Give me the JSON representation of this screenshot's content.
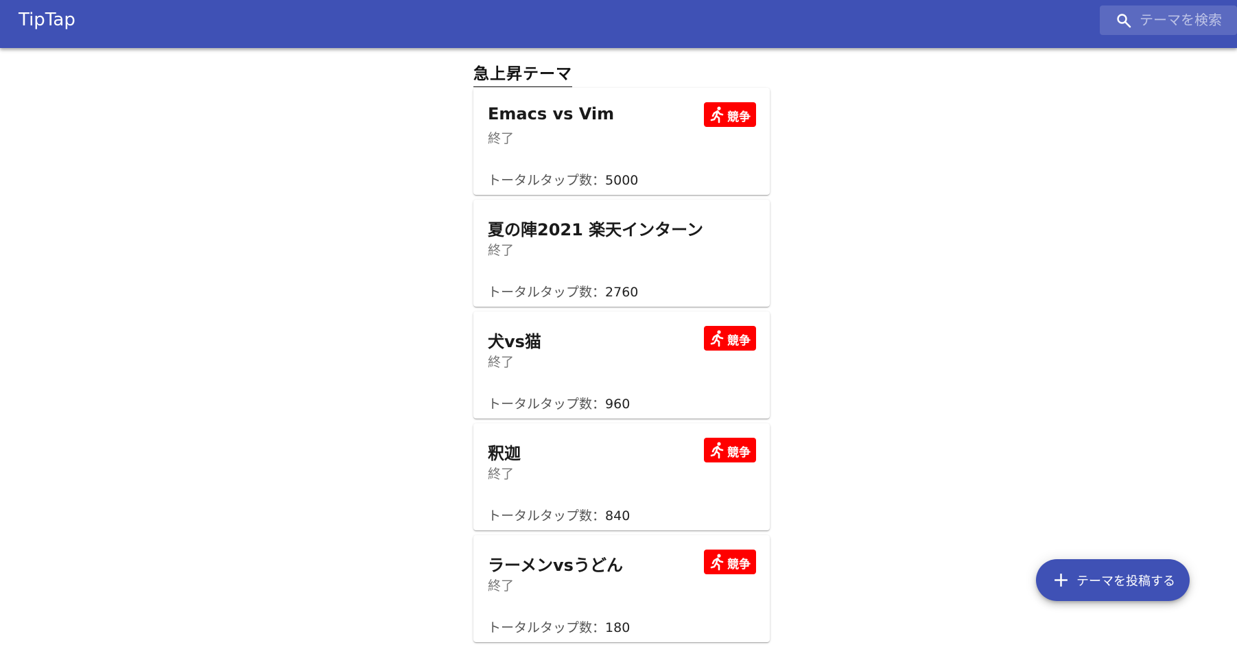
{
  "header": {
    "title": "TipTap",
    "search_placeholder": "テーマを検索"
  },
  "section": {
    "title": "急上昇テーマ"
  },
  "total_label": "トータルタップ数：",
  "themes": [
    {
      "title": "Emacs vs Vim",
      "status": "終了",
      "total": "5000",
      "badge": "競争"
    },
    {
      "title": "夏の陣2021 楽天インターン",
      "status": "終了",
      "total": "2760",
      "badge": ""
    },
    {
      "title": "犬vs猫",
      "status": "終了",
      "total": "960",
      "badge": "競争"
    },
    {
      "title": "釈迦",
      "status": "終了",
      "total": "840",
      "badge": "競争"
    },
    {
      "title": "ラーメンvsうどん",
      "status": "終了",
      "total": "180",
      "badge": "競争"
    }
  ],
  "fab": {
    "label": "テーマを投稿する"
  },
  "colors": {
    "primary": "#3f51b5",
    "badge": "#ff0000"
  }
}
